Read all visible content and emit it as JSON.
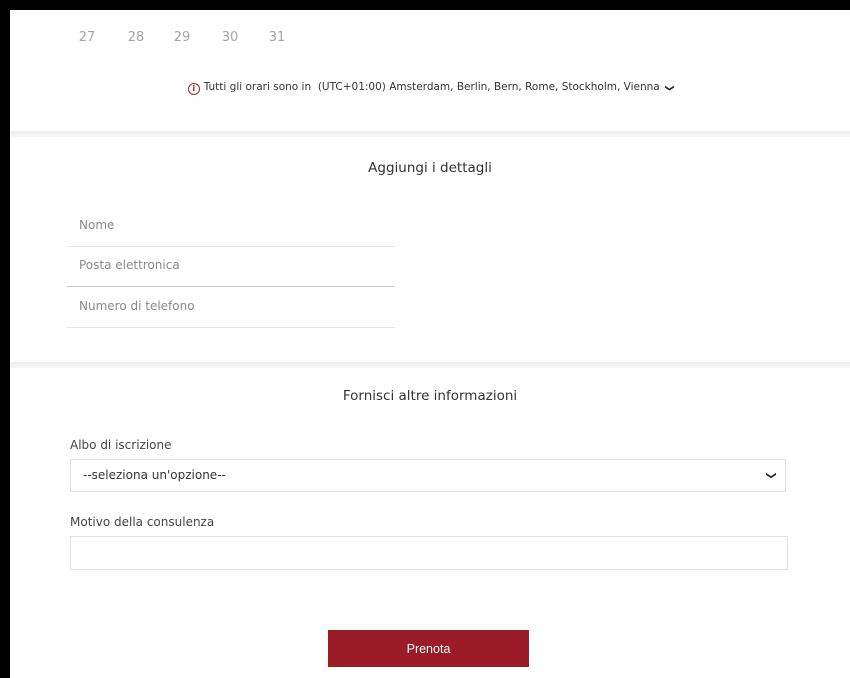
{
  "calendar": {
    "days": [
      "27",
      "28",
      "29",
      "30",
      "31"
    ]
  },
  "timezone": {
    "prefix": "Tutti gli orari sono in",
    "value": "(UTC+01:00) Amsterdam, Berlin, Bern, Rome, Stockholm, Vienna",
    "icon": "info-icon",
    "accent_color": "#a4262c"
  },
  "details": {
    "title": "Aggiungi i dettagli",
    "name_placeholder": "Nome",
    "email_placeholder": "Posta elettronica",
    "phone_placeholder": "Numero di telefono"
  },
  "more_info": {
    "title": "Fornisci altre informazioni",
    "register_label": "Albo di iscrizione",
    "register_selected": "--seleziona un'opzione--",
    "reason_label": "Motivo della consulenza",
    "reason_value": ""
  },
  "actions": {
    "book_label": "Prenota",
    "book_color": "#9b1c26"
  }
}
